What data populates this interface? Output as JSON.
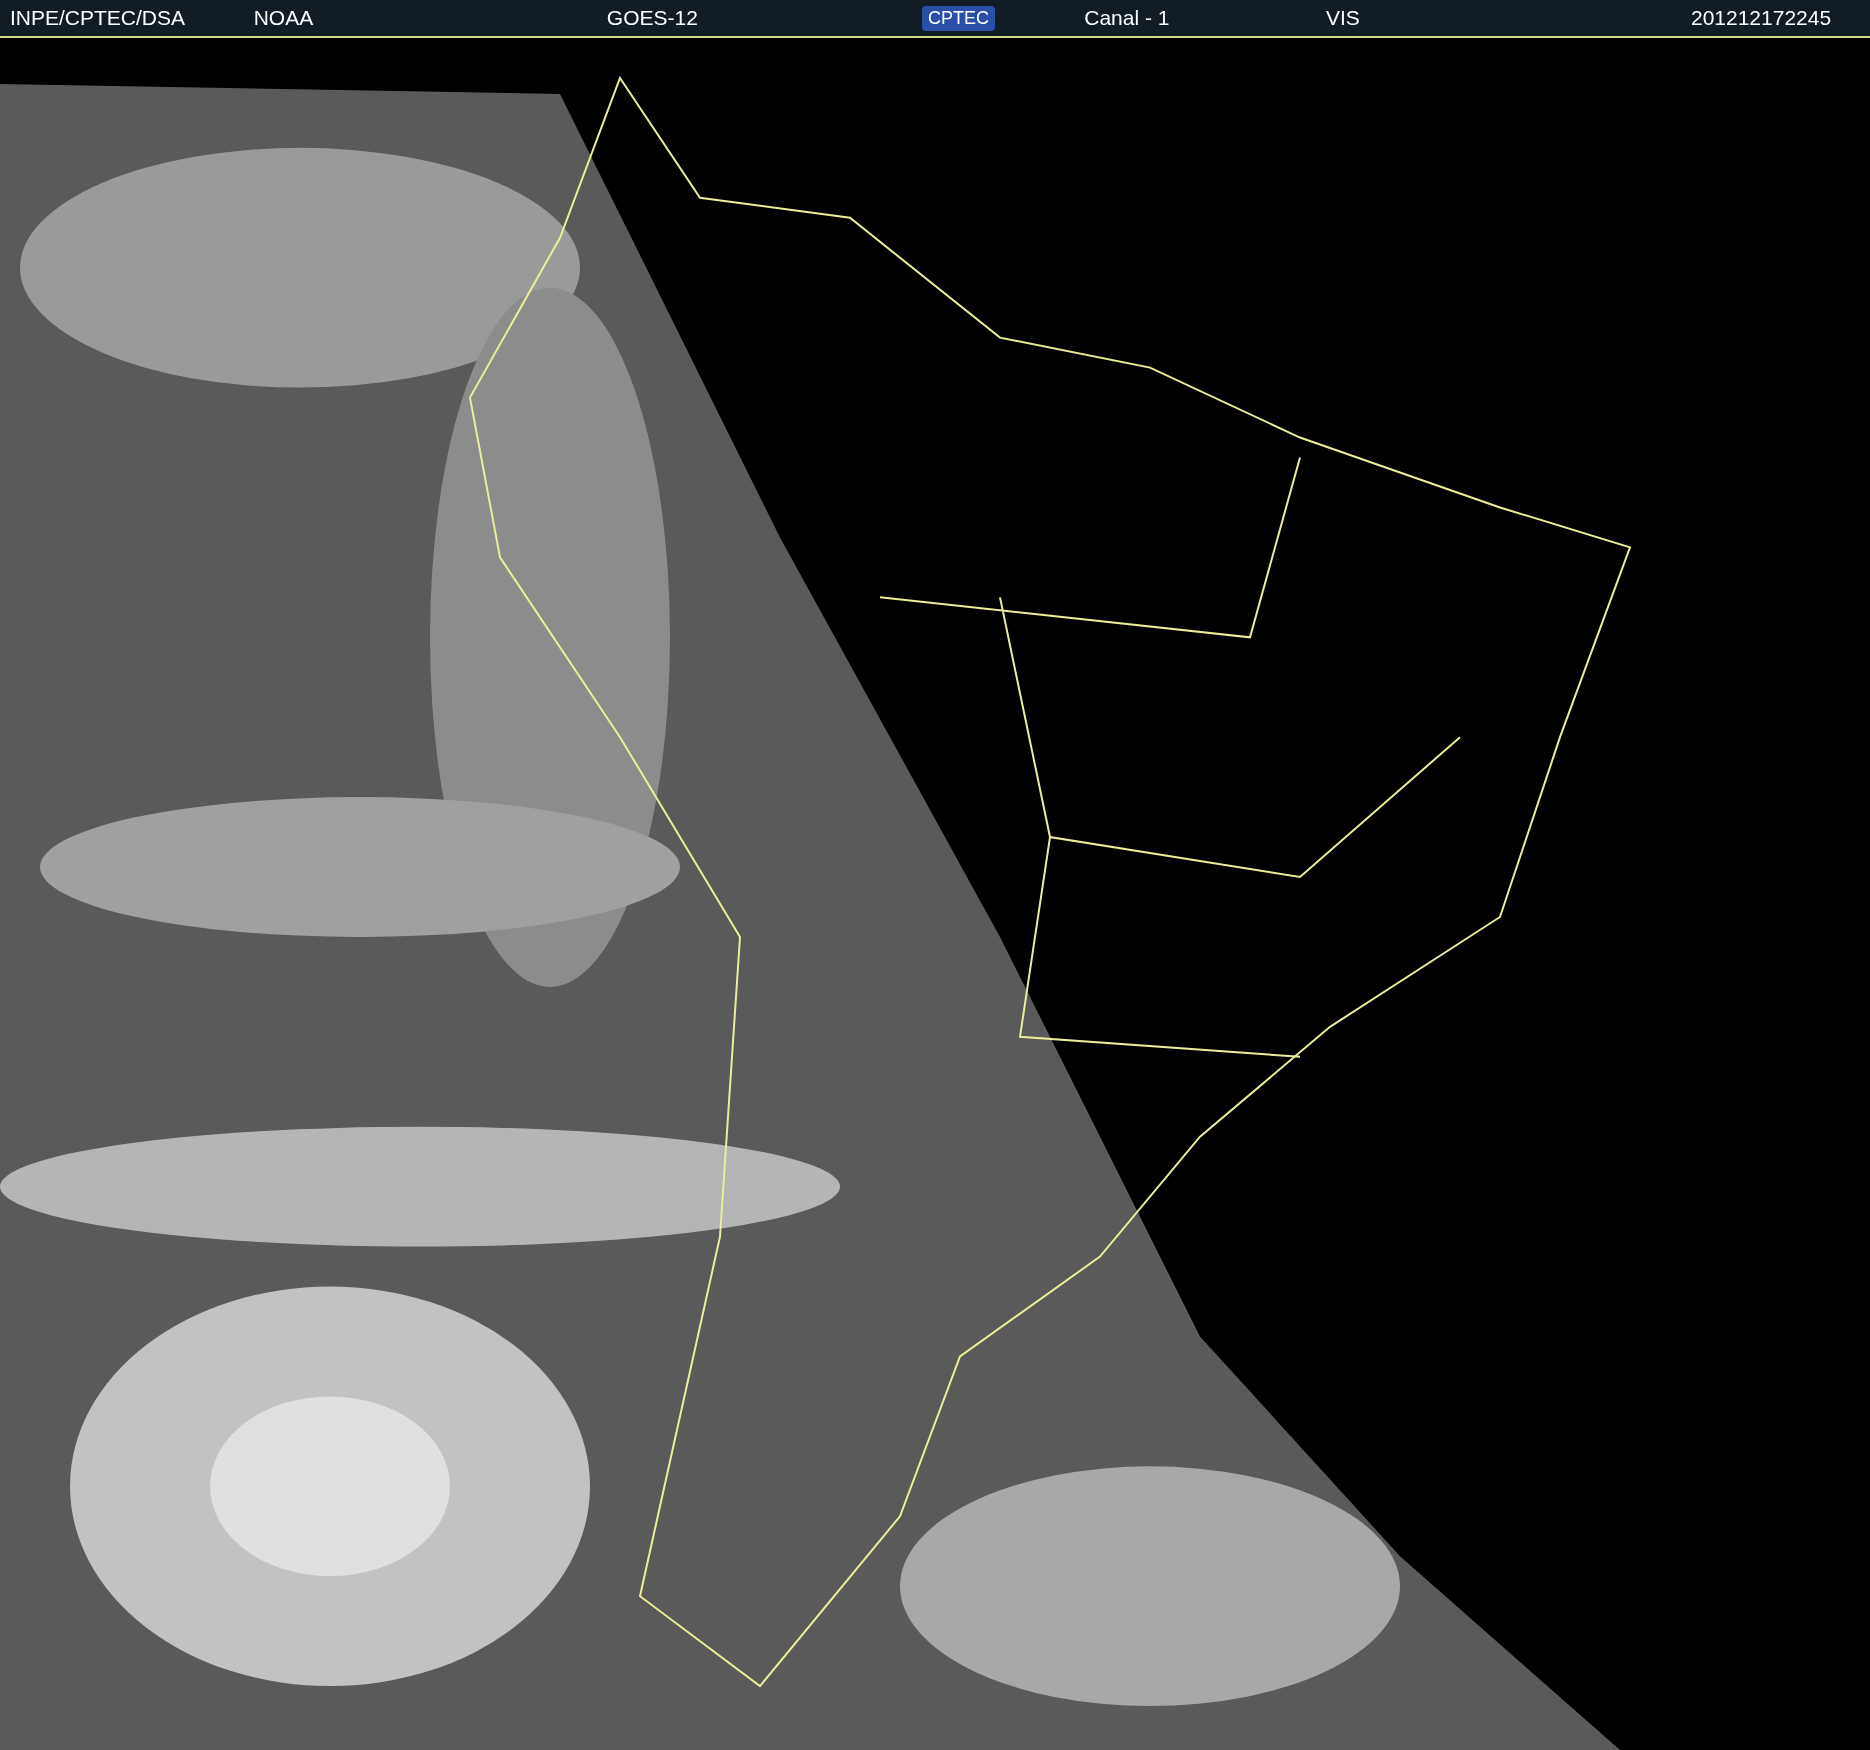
{
  "header": {
    "items": [
      {
        "kind": "text",
        "text": "INPE/CPTEC/DSA"
      },
      {
        "kind": "text",
        "text": "NOAA"
      },
      {
        "kind": "text",
        "text": "GOES-12"
      },
      {
        "kind": "logo",
        "text": "CPTEC"
      },
      {
        "kind": "text",
        "text": "Canal - 1"
      },
      {
        "kind": "text",
        "text": "VIS"
      },
      {
        "kind": "text",
        "text": "201212172245"
      }
    ]
  }
}
